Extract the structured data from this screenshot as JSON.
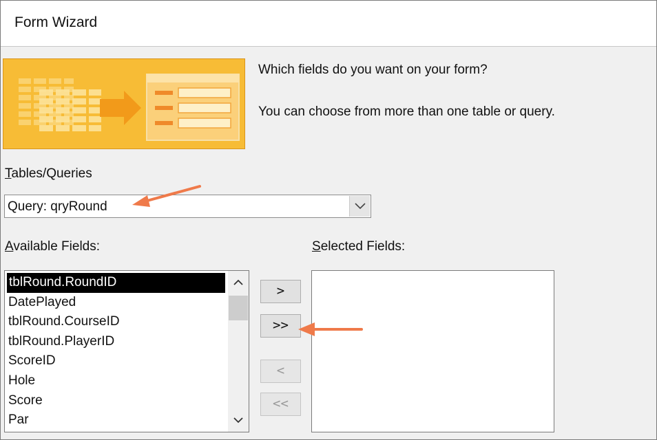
{
  "window": {
    "title": "Form Wizard"
  },
  "colors": {
    "accent_orange": "#ef7a4a",
    "banner_orange": "#f5b72b",
    "selection": "#000000"
  },
  "prompt": {
    "line1": "Which fields do you want on your form?",
    "line2": "You can choose from more than one table or query."
  },
  "tables_queries": {
    "label_accel": "T",
    "label_rest": "ables/Queries",
    "selected_value": "Query: qryRound"
  },
  "available": {
    "label_accel": "A",
    "label_rest": "vailable Fields:",
    "items": [
      "tblRound.RoundID",
      "DatePlayed",
      "tblRound.CourseID",
      "tblRound.PlayerID",
      "ScoreID",
      "Hole",
      "Score",
      "Par"
    ]
  },
  "selected": {
    "label_accel": "S",
    "label_rest": "elected Fields:",
    "items": []
  },
  "buttons": {
    "add_one": ">",
    "add_all": ">>",
    "remove_one": "<",
    "remove_all": "<<"
  },
  "icons": {
    "banner": "form-wizard-banner-icon",
    "combo_arrow": "chevron-down-icon",
    "scroll_up": "chevron-up-icon",
    "scroll_down": "chevron-down-icon",
    "annotation": "arrow-left-icon"
  }
}
